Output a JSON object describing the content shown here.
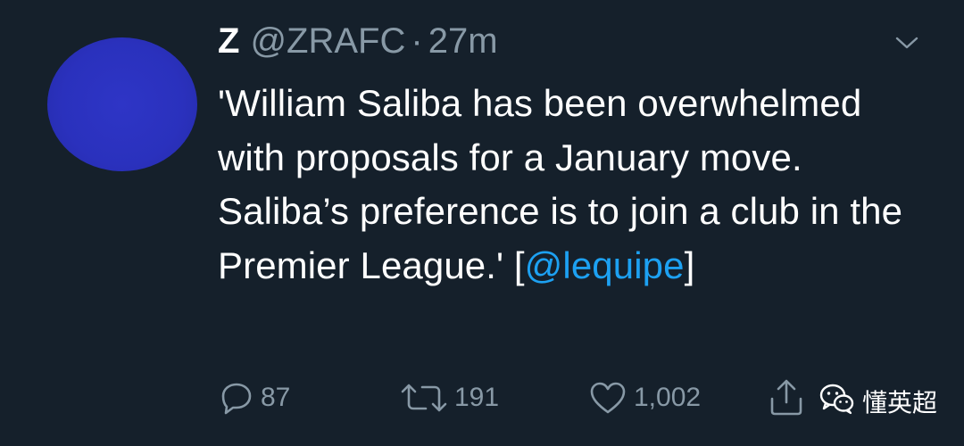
{
  "tweet": {
    "display_name": "Z",
    "handle": "@ZRAFC",
    "separator": "·",
    "time": "27m",
    "body_text": "'William Saliba has been overwhelmed with proposals for a January move. Saliba’s preference is to join a club in the Premier League.' [",
    "mention": "@lequipe",
    "body_tail": "]"
  },
  "actions": {
    "reply_count": "87",
    "retweet_count": "191",
    "like_count": "1,002"
  },
  "watermark": {
    "text": "懂英超"
  },
  "colors": {
    "background": "#15202b",
    "avatar": "#2a31bd",
    "secondary_text": "#8899a6",
    "link": "#1da1f2"
  },
  "icons": [
    "chevron-down-icon",
    "reply-icon",
    "retweet-icon",
    "like-icon",
    "share-icon",
    "wechat-icon"
  ]
}
